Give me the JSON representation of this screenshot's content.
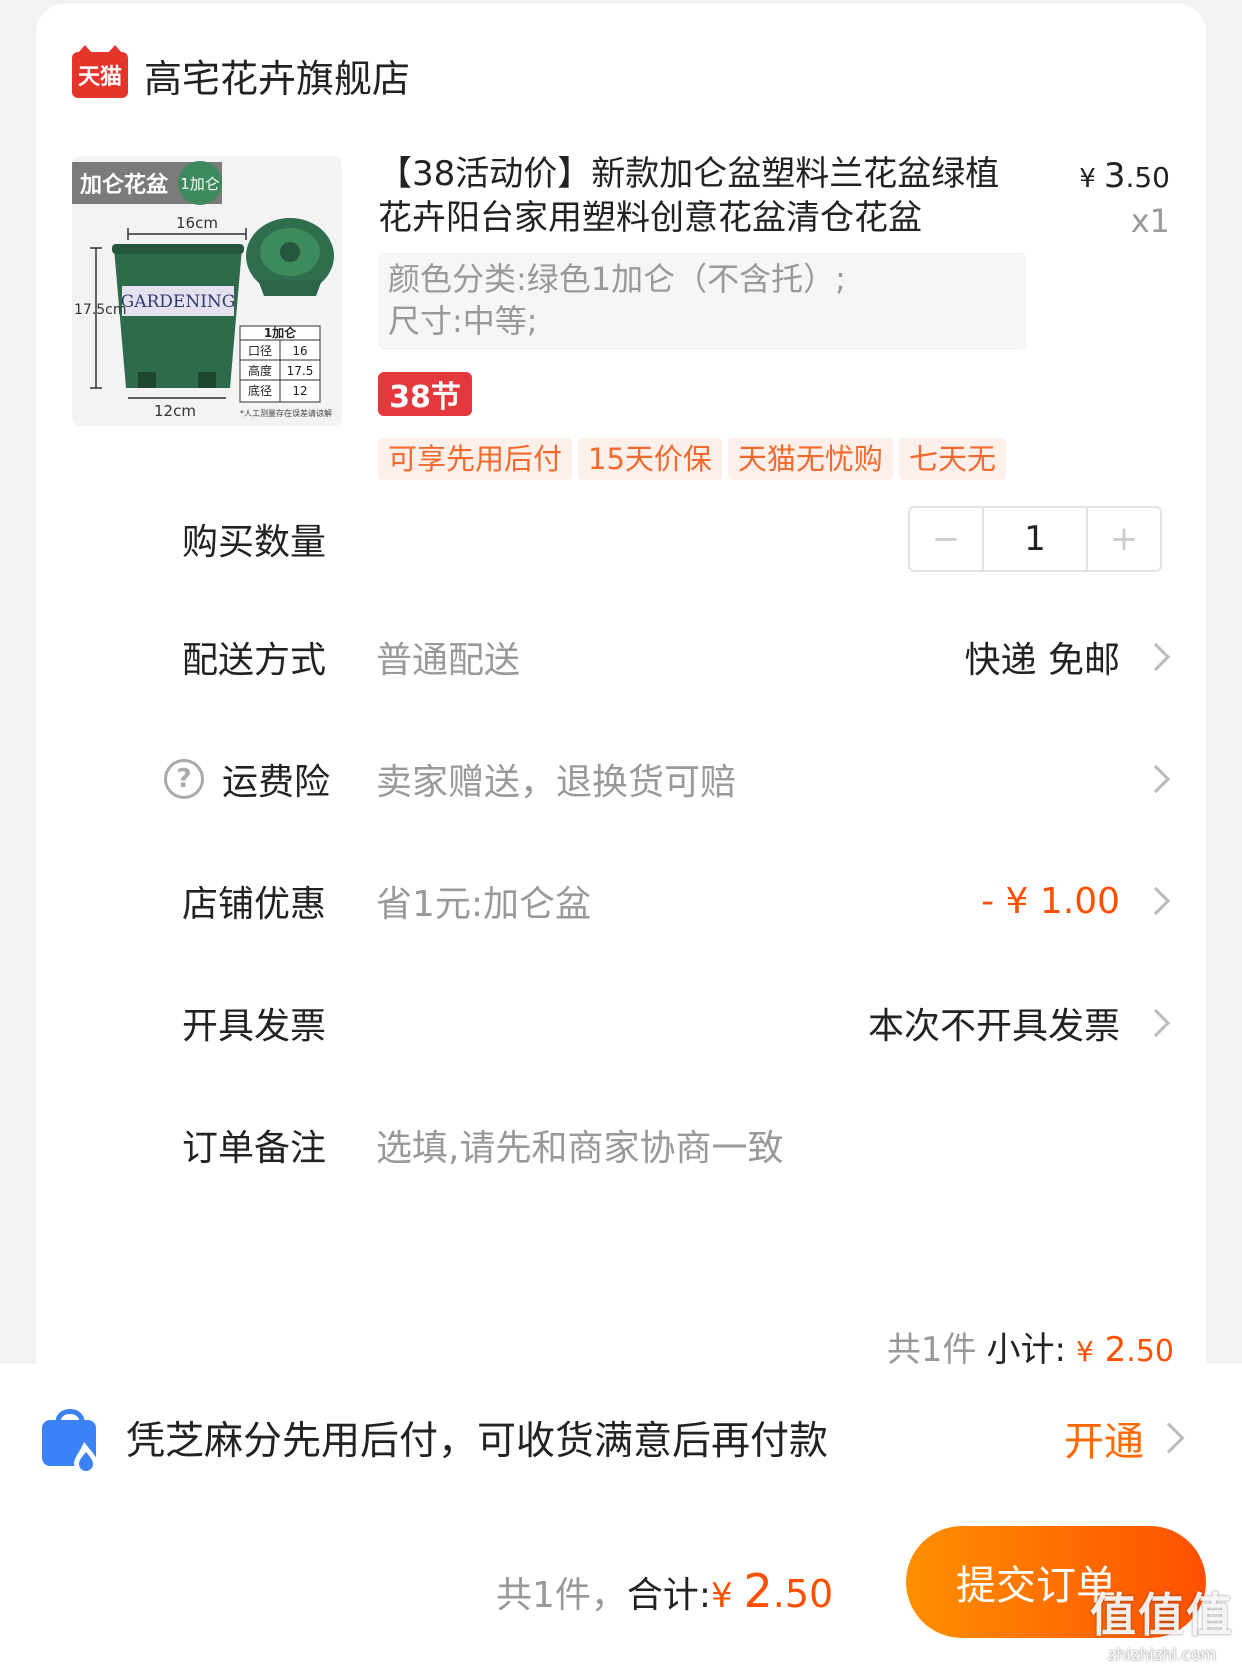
{
  "store": {
    "logo_text": "天猫",
    "name": "高宅花卉旗舰店"
  },
  "product": {
    "title": "【38活动价】新款加仑盆塑料兰花盆绿植花卉阳台家用塑料创意花盆清仓花盆",
    "price_currency": "¥",
    "price_int": "3",
    "price_dec": ".50",
    "quantity_label": "x1",
    "sku_color": "颜色分类:绿色1加仑（不含托）;",
    "sku_size": "尺寸:中等;",
    "promo_badge": "38节",
    "service_tags": [
      "可享先用后付",
      "15天价保",
      "天猫无忧购",
      "七天无"
    ],
    "image": {
      "tag": "加仑花盆",
      "tag_badge": "1加仑",
      "dim_top": "16cm",
      "dim_side": "17.5cm",
      "dim_bottom": "12cm",
      "pot_label": "GARDENING",
      "spec_header": "1加仑",
      "spec_rows": [
        [
          "口径",
          "16"
        ],
        [
          "高度",
          "17.5"
        ],
        [
          "底径",
          "12"
        ]
      ],
      "footnote": "*人工测量存在误差请谅解"
    }
  },
  "rows": {
    "quantity": {
      "label": "购买数量",
      "value": "1",
      "minus": "−",
      "plus": "+"
    },
    "delivery": {
      "label": "配送方式",
      "sub": "普通配送",
      "value": "快递 免邮"
    },
    "insurance": {
      "label": "运费险",
      "sub": "卖家赠送，退换货可赔",
      "help": "?"
    },
    "discount": {
      "label": "店铺优惠",
      "sub": "省1元:加仑盆",
      "value": "- ¥ 1.00"
    },
    "invoice": {
      "label": "开具发票",
      "value": "本次不开具发票"
    },
    "note": {
      "label": "订单备注",
      "placeholder": "选填,请先和商家协商一致"
    }
  },
  "subtotal": {
    "count": "共1件",
    "label": "小计:",
    "currency": "¥",
    "int": "2",
    "dec": ".50"
  },
  "pay_later": {
    "text": "凭芝麻分先用后付，可收货满意后再付款",
    "action": "开通"
  },
  "footer": {
    "count": "共1件，",
    "label": "合计:",
    "currency": "¥ ",
    "int": "2",
    "dec": ".50",
    "submit": "提交订单"
  },
  "watermark": {
    "text": "值值值",
    "url": "zhizhizhi.com"
  },
  "colors": {
    "accent": "#ff5000",
    "tmall_red": "#e5352b",
    "pot_green": "#2e6b4b"
  }
}
